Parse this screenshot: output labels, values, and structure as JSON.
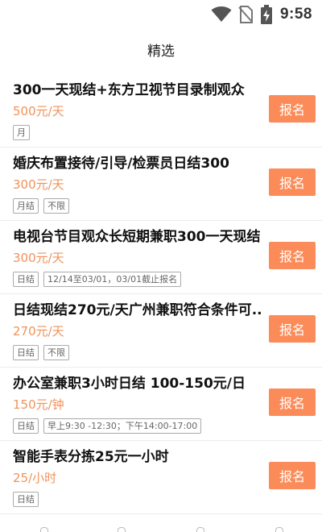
{
  "status_bar": {
    "time": "9:58",
    "icons": [
      "wifi-icon",
      "no-sim-icon",
      "battery-charging-icon"
    ]
  },
  "header": {
    "title": "精选"
  },
  "colors": {
    "accent": "#fb8c5a",
    "pay_text": "#f0925a",
    "tag_border": "#aaaaaa"
  },
  "jobs": [
    {
      "title": "300一天现结+东方卫视节目录制观众",
      "pay": "500元/天",
      "tags": [
        "月"
      ],
      "button": "报名"
    },
    {
      "title": "婚庆布置接待/引导/检票员日结300",
      "pay": "300元/天",
      "tags": [
        "月结",
        "不限"
      ],
      "button": "报名"
    },
    {
      "title": "电视台节目观众长短期兼职300一天现结",
      "pay": "300元/天",
      "tags": [
        "日结",
        "12/14至03/01，03/01截止报名"
      ],
      "button": "报名"
    },
    {
      "title": "日结现结270元/天广州兼职符合条件可..",
      "pay": "270元/天",
      "tags": [
        "日结",
        "不限"
      ],
      "button": "报名"
    },
    {
      "title": "办公室兼职3小时日结 100-150元/日",
      "pay": "150元/钟",
      "tags": [
        "日结",
        "早上9:30 -12:30；下午14:00-17:00"
      ],
      "button": "报名"
    },
    {
      "title": "智能手表分拣25元一小时",
      "pay": "25/小时",
      "tags": [
        "日结"
      ],
      "button": "报名"
    }
  ]
}
